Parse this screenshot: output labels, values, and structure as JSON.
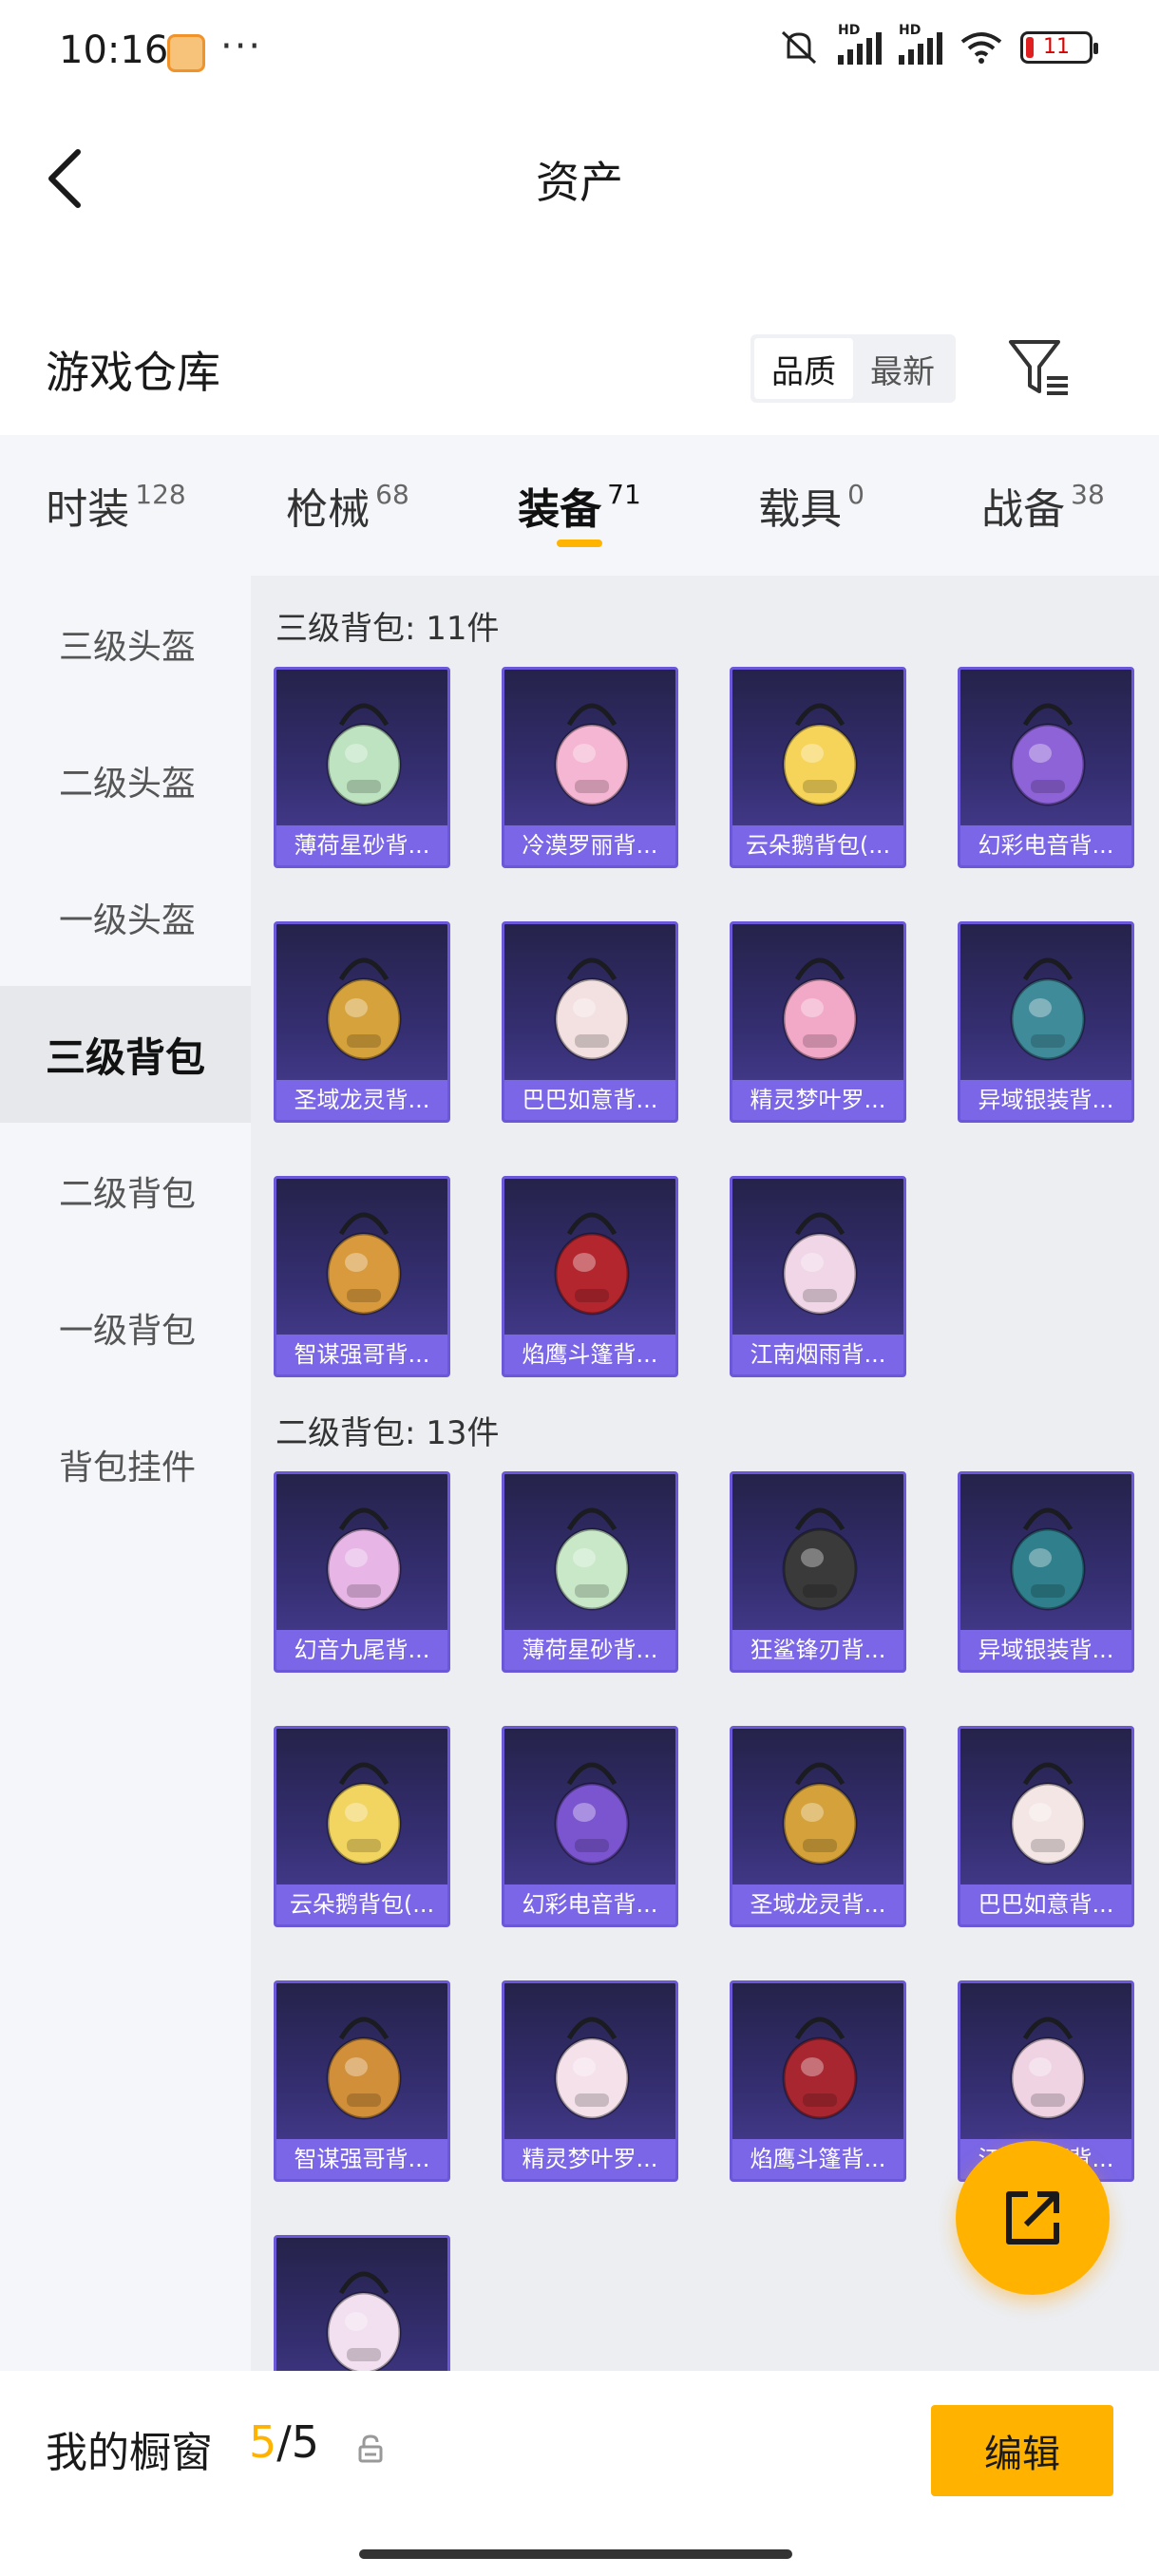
{
  "status_bar": {
    "time": "10:16",
    "dots": "···",
    "hd": "HD",
    "battery": "11"
  },
  "header": {
    "title": "资产"
  },
  "warehouse": {
    "title": "游戏仓库",
    "sort_options": [
      "品质",
      "最新"
    ],
    "sort_selected": "品质"
  },
  "tabs": [
    {
      "label": "时装",
      "count": "128"
    },
    {
      "label": "枪械",
      "count": "68"
    },
    {
      "label": "装备",
      "count": "71"
    },
    {
      "label": "载具",
      "count": "0"
    },
    {
      "label": "战备",
      "count": "38"
    }
  ],
  "active_tab": "装备",
  "sidebar": [
    {
      "label": "三级头盔"
    },
    {
      "label": "二级头盔"
    },
    {
      "label": "一级头盔"
    },
    {
      "label": "三级背包"
    },
    {
      "label": "二级背包"
    },
    {
      "label": "一级背包"
    },
    {
      "label": "背包挂件"
    }
  ],
  "active_sidebar": "三级背包",
  "sections": [
    {
      "title": "三级背包: 11件",
      "items": [
        {
          "label": "薄荷星砂背...",
          "color": "#bde3c0"
        },
        {
          "label": "冷漠罗丽背...",
          "color": "#f4b6d2"
        },
        {
          "label": "云朵鹅背包(...",
          "color": "#f6d45a"
        },
        {
          "label": "幻彩电音背...",
          "color": "#8e63d8"
        },
        {
          "label": "圣域龙灵背...",
          "color": "#d6a23c"
        },
        {
          "label": "巴巴如意背...",
          "color": "#f3e1e1"
        },
        {
          "label": "精灵梦叶罗...",
          "color": "#f2a9c8"
        },
        {
          "label": "异域银装背...",
          "color": "#3f8b9a"
        },
        {
          "label": "智谋强哥背...",
          "color": "#d89a3c"
        },
        {
          "label": "焰鹰斗篷背...",
          "color": "#b3262e"
        },
        {
          "label": "江南烟雨背...",
          "color": "#f0d6e6"
        }
      ]
    },
    {
      "title": "二级背包: 13件",
      "items": [
        {
          "label": "幻音九尾背...",
          "color": "#e7b6e6"
        },
        {
          "label": "薄荷星砂背...",
          "color": "#c8e8c8"
        },
        {
          "label": "狂鲨锋刃背...",
          "color": "#3a3a3a"
        },
        {
          "label": "异域银装背...",
          "color": "#2f7f8c"
        },
        {
          "label": "云朵鹅背包(...",
          "color": "#f2d560"
        },
        {
          "label": "幻彩电音背...",
          "color": "#7b55cf"
        },
        {
          "label": "圣域龙灵背...",
          "color": "#d4a13a"
        },
        {
          "label": "巴巴如意背...",
          "color": "#f5e6e6"
        },
        {
          "label": "智谋强哥背...",
          "color": "#d28f3a"
        },
        {
          "label": "精灵梦叶罗...",
          "color": "#f5e1ea"
        },
        {
          "label": "焰鹰斗篷背...",
          "color": "#a82630"
        },
        {
          "label": "江南烟雨背...",
          "color": "#efd3e3"
        },
        {
          "label": "",
          "color": "#f2dff0"
        }
      ]
    }
  ],
  "bottom": {
    "title": "我的橱窗",
    "current": "5",
    "total": "/5",
    "edit": "编辑"
  }
}
